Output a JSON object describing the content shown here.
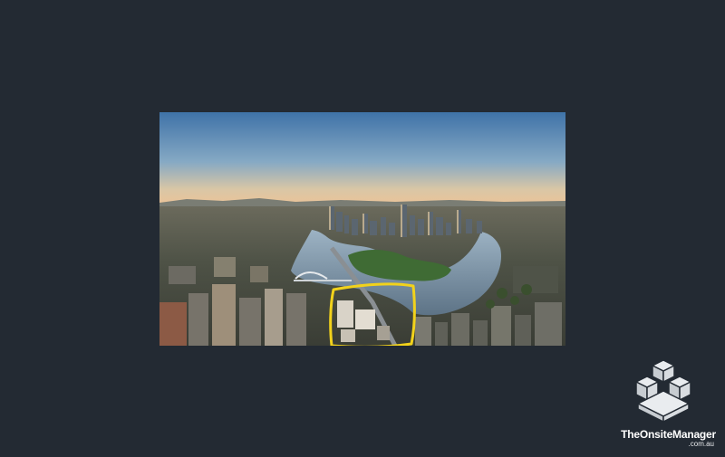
{
  "photo": {
    "subject": "aerial-city-river-view",
    "highlight_color": "#f2d21b"
  },
  "watermark": {
    "brand": "TheOnsiteManager",
    "domain": ".com.au",
    "icon": "stacked-cubes-logo-icon"
  }
}
